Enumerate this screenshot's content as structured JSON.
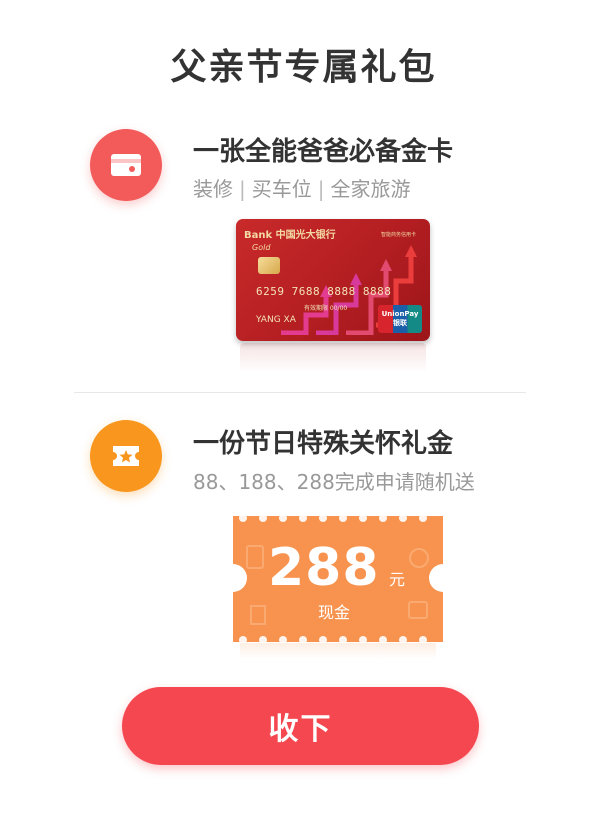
{
  "title": "父亲节专属礼包",
  "items": [
    {
      "title": "一张全能爸爸必备金卡",
      "sub": [
        "装修",
        "买车位",
        "全家旅游"
      ],
      "separator": "|",
      "icon": "credit-card-icon",
      "color": "#f35a5a"
    },
    {
      "title": "一份节日特殊关怀礼金",
      "sub_text": "88、188、288完成申请随机送",
      "icon": "coupon-star-icon",
      "color": "#f8961e"
    }
  ],
  "card": {
    "brand": "Bank 中国光大银行",
    "gold": "Gold",
    "tag": "智能商务信用卡",
    "number": "6259 7688 8888 8888",
    "valid": "有效期限 00/00",
    "holder": "YANG  XA",
    "union_en": "UnionPay",
    "union_cn": "银联"
  },
  "ticket": {
    "amount": "288",
    "unit": "元",
    "label": "现金",
    "color": "#f7934e"
  },
  "button": {
    "label": "收下",
    "color": "#f5474f"
  }
}
